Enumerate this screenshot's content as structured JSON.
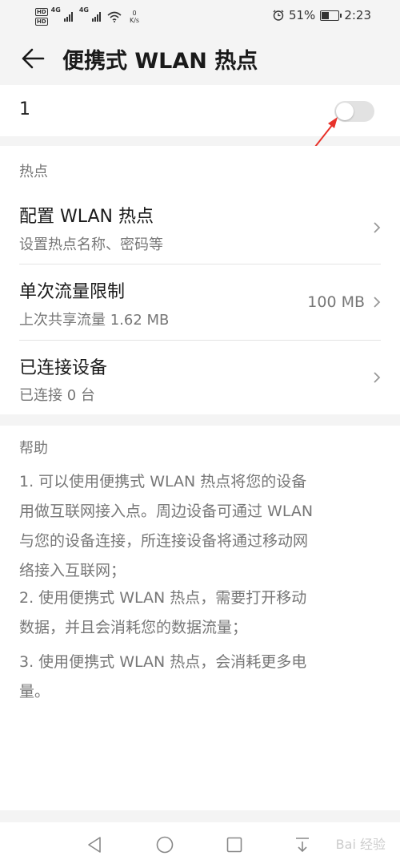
{
  "status_bar": {
    "hd1": "HD",
    "hd2": "HD",
    "net1": "4G",
    "net2": "4G",
    "speed_value": "0",
    "speed_unit": "K/s",
    "battery_percent": "51%",
    "battery_level": 0.51,
    "time": "2:23",
    "icons": [
      "alarm-icon",
      "battery-icon",
      "wifi-icon",
      "signal-icon"
    ]
  },
  "app_bar": {
    "title": "便携式 WLAN 热点",
    "back_icon": "arrow-left-icon"
  },
  "hotspot_toggle": {
    "label": "1",
    "enabled": false
  },
  "annotation": {
    "color": "#e8322a"
  },
  "settings": {
    "section_header": "热点",
    "items": [
      {
        "title": "配置 WLAN 热点",
        "subtitle": "设置热点名称、密码等",
        "value": ""
      },
      {
        "title": "单次流量限制",
        "subtitle": "上次共享流量 1.62 MB",
        "value": "100 MB"
      },
      {
        "title": "已连接设备",
        "subtitle": "已连接 0 台",
        "value": ""
      }
    ]
  },
  "help": {
    "header": "帮助",
    "paragraphs": [
      [
        "1. 可以使用便携式 WLAN 热点将您的设备",
        "用做互联网接入点。周边设备可通过 WLAN",
        "与您的设备连接，所连接设备将通过移动网",
        "络接入互联网；"
      ],
      [
        "2. 使用便携式 WLAN 热点，需要打开移动",
        "数据，并且会消耗您的数据流量；"
      ],
      [
        "3. 使用便携式 WLAN 热点，会消耗更多电",
        "量。"
      ]
    ]
  },
  "nav_bar": {
    "icons": [
      "back-triangle-icon",
      "home-circle-icon",
      "recents-square-icon",
      "notification-down-icon"
    ],
    "watermark": "Bai 经验"
  }
}
